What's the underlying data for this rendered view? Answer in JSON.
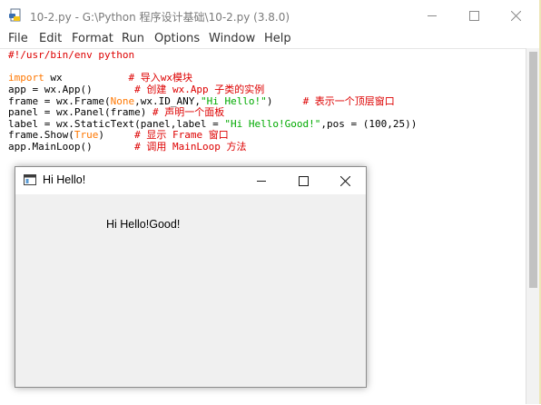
{
  "idle_window": {
    "title": "10-2.py - G:\\Python 程序设计基础\\10-2.py (3.8.0)",
    "menu": [
      "File",
      "Edit",
      "Format",
      "Run",
      "Options",
      "Window",
      "Help"
    ],
    "code_lines": [
      [
        {
          "t": "#!/usr/bin/env python",
          "c": "comment"
        }
      ],
      [
        {
          "t": "",
          "c": "plain"
        }
      ],
      [
        {
          "t": "import",
          "c": "kw"
        },
        {
          "t": " wx           ",
          "c": "plain"
        },
        {
          "t": "# 导入wx模块",
          "c": "comment"
        }
      ],
      [
        {
          "t": "app = wx.App()       ",
          "c": "plain"
        },
        {
          "t": "# 创建 wx.App 子类的实例",
          "c": "comment"
        }
      ],
      [
        {
          "t": "frame = wx.Frame(",
          "c": "plain"
        },
        {
          "t": "None",
          "c": "kw"
        },
        {
          "t": ",wx.ID_ANY,",
          "c": "plain"
        },
        {
          "t": "\"Hi Hello!\"",
          "c": "str"
        },
        {
          "t": ")     ",
          "c": "plain"
        },
        {
          "t": "# 表示一个顶层窗口",
          "c": "comment"
        }
      ],
      [
        {
          "t": "panel = wx.Panel(frame) ",
          "c": "plain"
        },
        {
          "t": "# 声明一个面板",
          "c": "comment"
        }
      ],
      [
        {
          "t": "label = wx.StaticText(panel,label = ",
          "c": "plain"
        },
        {
          "t": "\"Hi Hello!Good!\"",
          "c": "str"
        },
        {
          "t": ",pos = (100,25))",
          "c": "plain"
        }
      ],
      [
        {
          "t": "frame.Show(",
          "c": "plain"
        },
        {
          "t": "True",
          "c": "kw"
        },
        {
          "t": ")     ",
          "c": "plain"
        },
        {
          "t": "# 显示 Frame 窗口",
          "c": "comment"
        }
      ],
      [
        {
          "t": "app.MainLoop()       ",
          "c": "plain"
        },
        {
          "t": "# 调用 MainLoop 方法",
          "c": "comment"
        }
      ]
    ]
  },
  "wx_frame": {
    "title": "Hi Hello!",
    "static_text": "Hi Hello!Good!"
  },
  "icons": {
    "idle_app": "python-idle-icon",
    "wx_app": "wx-window-icon",
    "minimize": "minimize-icon",
    "maximize": "maximize-icon",
    "close": "close-icon"
  },
  "colors": {
    "keyword": "#ff7700",
    "comment": "#dd0000",
    "string": "#00aa00"
  }
}
